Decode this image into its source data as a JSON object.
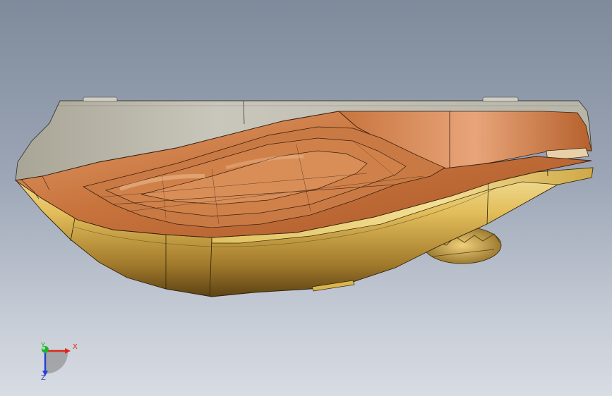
{
  "triad": {
    "x_label": "X",
    "y_label": "Y",
    "z_label": "Z",
    "x_color": "#e0261b",
    "y_color": "#1fb32a",
    "z_color": "#2a3fd6"
  },
  "model": {
    "shell_color": "#e8c25a",
    "interior_color": "#c8733c",
    "rim_color": "#bdbbb0"
  }
}
